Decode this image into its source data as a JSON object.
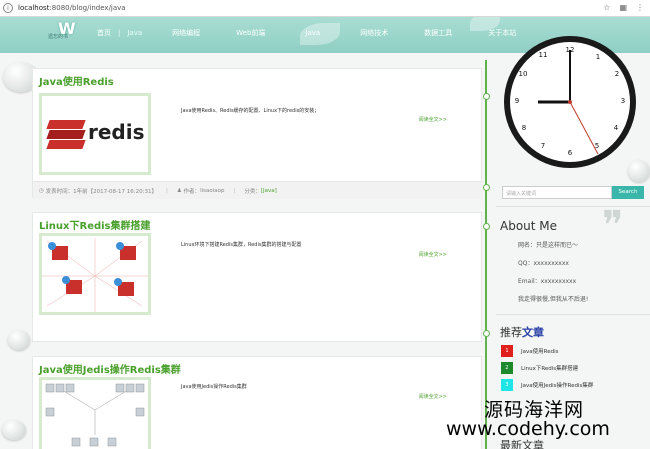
{
  "browser": {
    "url": "localhost:8080/blog/index/java",
    "url_host": "localhost",
    "url_rest": ":8080/blog/index/java"
  },
  "header": {
    "logo_text": "W",
    "subtitle": "遗忘的书",
    "nav": [
      "首页",
      "Java",
      "网络编程",
      "Web前端",
      "Java",
      "网络技术",
      "数据工具",
      "关于本站"
    ]
  },
  "posts": [
    {
      "title": "Java使用Redis",
      "excerpt": "Java使用Redis、Redis缓存的配置、Linux下的redis的安装；",
      "more": "阅读全文>>",
      "thumb_label": "redis",
      "meta": {
        "time_label": "发表时间：",
        "time": "1年前【2017-08-17 16:20:31】",
        "author_label": "作者：",
        "author": "lisaoiaop",
        "cat_label": "分类：",
        "cat": "[Java]"
      }
    },
    {
      "title": "Linux下Redis集群搭建",
      "excerpt": "Linux环境下搭建Redis集群，Redis集群的搭建与配置",
      "more": "阅读全文>>"
    },
    {
      "title": "Java使用Jedis操作Redis集群",
      "excerpt": "Java使用Jedis操作Redis集群",
      "more": "阅读全文>>"
    }
  ],
  "clock": {
    "numbers": [
      "12",
      "1",
      "2",
      "3",
      "4",
      "5",
      "6",
      "7",
      "8",
      "9",
      "10",
      "11"
    ]
  },
  "search": {
    "placeholder": "请输入关键词",
    "button": "Search"
  },
  "about": {
    "heading": "About Me",
    "name": "网名：只是这样而已～",
    "qq": "QQ：xxxxxxxxxx",
    "email": "Email：xxxxxxxxxx",
    "motto": "我走得很慢,但我从不后退!"
  },
  "recommend": {
    "heading_a": "推荐",
    "heading_b": "文章",
    "items": [
      {
        "n": "1",
        "title": "Java使用Redis",
        "color": "#e0201b"
      },
      {
        "n": "2",
        "title": "Linux下Redis集群搭建",
        "color": "#1c8a2c"
      },
      {
        "n": "3",
        "title": "Java使用Jedis操作Redis集群",
        "color": "#1ee6e6"
      }
    ]
  },
  "newest": {
    "heading": "最新文章"
  },
  "watermark": {
    "line1": "源码海洋网",
    "line2": "www.codehy.com"
  }
}
